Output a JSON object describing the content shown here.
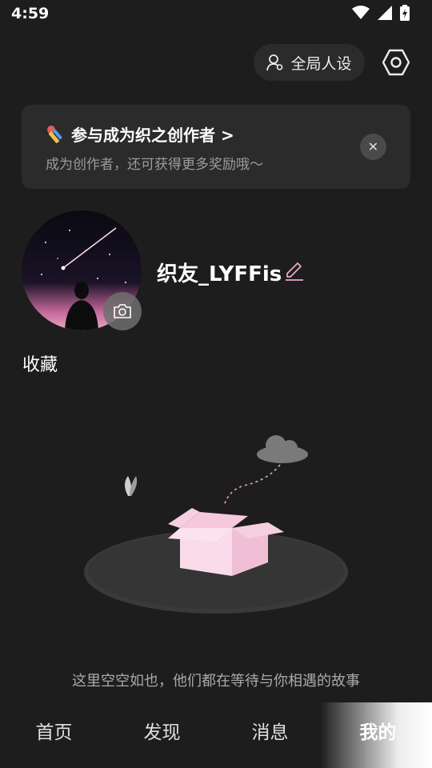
{
  "status_bar": {
    "time": "4:59"
  },
  "header": {
    "persona_label": "全局人设"
  },
  "banner": {
    "title": "参与成为织之创作者 >",
    "subtitle": "成为创作者，还可获得更多奖励哦～"
  },
  "profile": {
    "username": "织友_LYFFis"
  },
  "favorites": {
    "title": "收藏",
    "empty_text": "这里空空如也，他们都在等待与你相遇的故事"
  },
  "nav": {
    "items": [
      "首页",
      "发现",
      "消息",
      "我的"
    ],
    "active_index": 3
  },
  "colors": {
    "background": "#1d1d1d",
    "card": "#2b2b2b",
    "accent_pink": "#e8a7c6",
    "muted_text": "#9b9b9b"
  }
}
